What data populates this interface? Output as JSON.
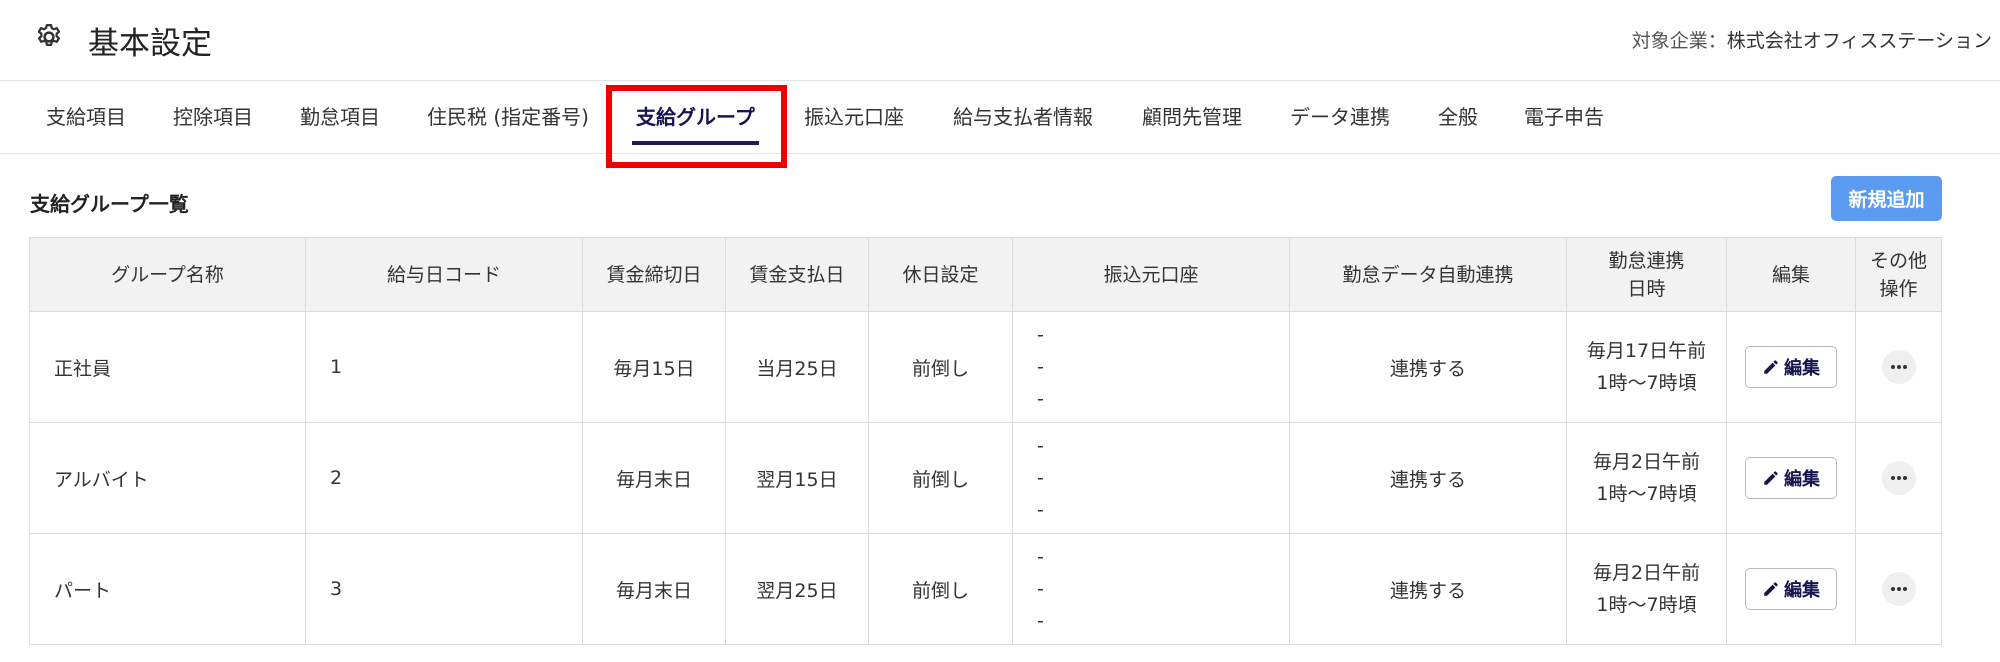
{
  "header": {
    "title": "基本設定",
    "company_label": "対象企業：",
    "company_name": "株式会社オフィスステーション"
  },
  "tabs": [
    {
      "label": "支給項目"
    },
    {
      "label": "控除項目"
    },
    {
      "label": "勤怠項目"
    },
    {
      "label": "住民税 (指定番号)"
    },
    {
      "label": "支給グループ",
      "active": true
    },
    {
      "label": "振込元口座"
    },
    {
      "label": "給与支払者情報"
    },
    {
      "label": "顧問先管理"
    },
    {
      "label": "データ連携"
    },
    {
      "label": "全般"
    },
    {
      "label": "電子申告"
    }
  ],
  "section": {
    "title": "支給グループ一覧",
    "add_label": "新規追加"
  },
  "table": {
    "headers": {
      "group_name": "グループ名称",
      "pay_code": "給与日コード",
      "cutoff": "賃金締切日",
      "payday": "賃金支払日",
      "holiday": "休日設定",
      "account": "振込元口座",
      "auto_link": "勤怠データ自動連携",
      "link_time_1": "勤怠連携",
      "link_time_2": "日時",
      "edit": "編集",
      "other_1": "その他",
      "other_2": "操作"
    },
    "rows": [
      {
        "group_name": "正社員",
        "pay_code": "1",
        "cutoff": "毎月15日",
        "payday": "当月25日",
        "holiday": "前倒し",
        "account": [
          "-",
          "-",
          "-"
        ],
        "auto_link": "連携する",
        "time_1": "毎月17日午前",
        "time_2": "1時〜7時頃",
        "edit_label": "編集"
      },
      {
        "group_name": "アルバイト",
        "pay_code": "2",
        "cutoff": "毎月末日",
        "payday": "翌月15日",
        "holiday": "前倒し",
        "account": [
          "-",
          "-",
          "-"
        ],
        "auto_link": "連携する",
        "time_1": "毎月2日午前",
        "time_2": "1時〜7時頃",
        "edit_label": "編集"
      },
      {
        "group_name": "パート",
        "pay_code": "3",
        "cutoff": "毎月末日",
        "payday": "翌月25日",
        "holiday": "前倒し",
        "account": [
          "-",
          "-",
          "-"
        ],
        "auto_link": "連携する",
        "time_1": "毎月2日午前",
        "time_2": "1時〜7時頃",
        "edit_label": "編集"
      }
    ]
  },
  "colors": {
    "accent_navy": "#1c1c5c",
    "highlight_red": "#ee0000",
    "add_button_blue": "#5b9cf0"
  }
}
